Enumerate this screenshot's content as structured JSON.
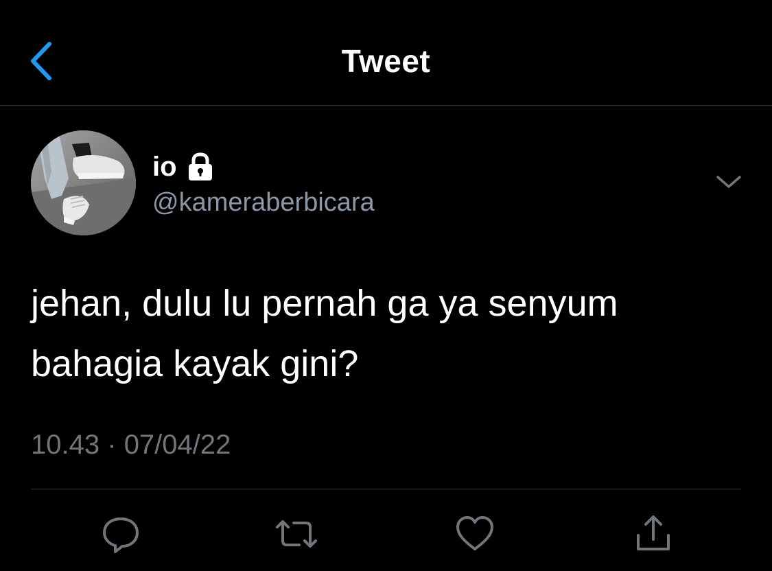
{
  "header": {
    "title": "Tweet",
    "back_icon": "chevron-left-icon"
  },
  "colors": {
    "background": "#000000",
    "accent": "#1d9bf0",
    "text_primary": "#ffffff",
    "text_secondary": "#71767b",
    "divider": "#2f3336"
  },
  "tweet": {
    "author": {
      "display_name": "io",
      "handle": "@kameraberbicara",
      "protected_icon": "lock-icon",
      "avatar": "avatar-photo-sneakers"
    },
    "text": "jehan, dulu lu pernah ga ya senyum\nbahagia kayak gini?",
    "time": "10.43",
    "separator": "·",
    "date": "07/04/22",
    "more_icon": "chevron-down-icon"
  },
  "actions": [
    {
      "name": "reply",
      "icon": "reply-icon"
    },
    {
      "name": "retweet",
      "icon": "retweet-icon"
    },
    {
      "name": "like",
      "icon": "heart-icon"
    },
    {
      "name": "share",
      "icon": "share-icon"
    }
  ]
}
